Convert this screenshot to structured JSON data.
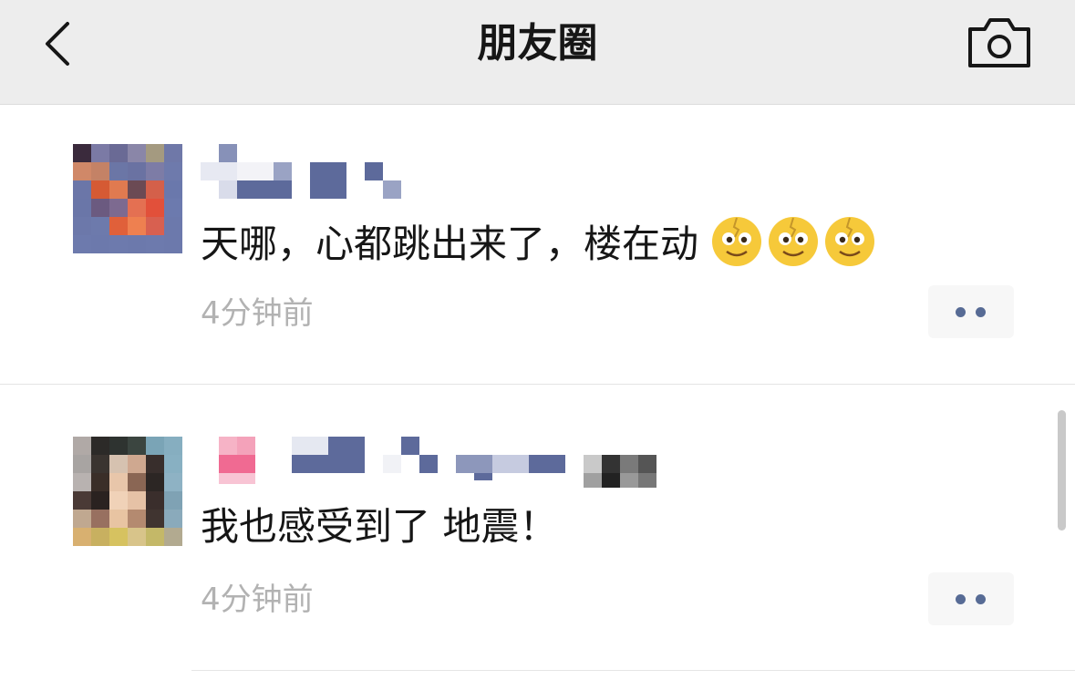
{
  "header": {
    "title": "朋友圈",
    "back_icon": "chevron-left-icon",
    "camera_icon": "camera-icon"
  },
  "posts": [
    {
      "text": "天哪，心都跳出来了，楼在动",
      "emoji_icon": "shocked-face-emoji",
      "emoji_count": 3,
      "time": "4分钟前"
    },
    {
      "text": "我也感受到了 地震！",
      "time": "4分钟前"
    }
  ],
  "colors": {
    "accent": "#576b95",
    "header_bg": "#ededed",
    "time_text": "#b2b2b2"
  }
}
